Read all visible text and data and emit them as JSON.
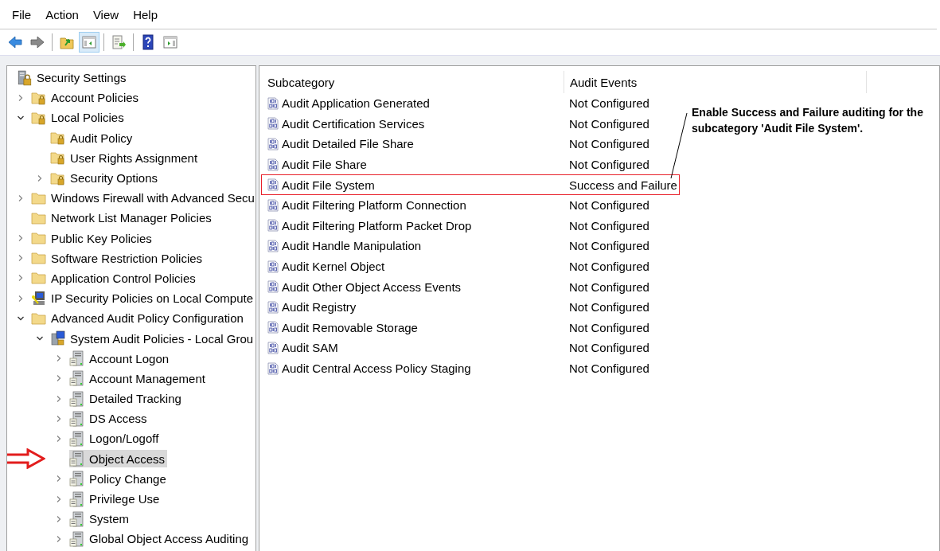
{
  "menu": [
    "File",
    "Action",
    "View",
    "Help"
  ],
  "toolbar": [
    {
      "kind": "back",
      "pressed": false
    },
    {
      "kind": "forward",
      "pressed": false
    },
    {
      "kind": "up",
      "pressed": false
    },
    {
      "kind": "tree",
      "pressed": true
    },
    {
      "kind": "export",
      "pressed": false
    },
    {
      "kind": "help",
      "pressed": false
    },
    {
      "kind": "pane",
      "pressed": false
    }
  ],
  "tree": {
    "label": "Security Settings",
    "kind": "settings",
    "selected": false,
    "children": [
      {
        "label": "Account Policies",
        "kind": "lockfolder",
        "expanded": false,
        "selected": false
      },
      {
        "label": "Local Policies",
        "kind": "lockfolder",
        "expanded": true,
        "selected": false,
        "children": [
          {
            "label": "Audit Policy",
            "kind": "lockfolder",
            "selected": false
          },
          {
            "label": "User Rights Assignment",
            "kind": "lockfolder",
            "selected": false
          },
          {
            "label": "Security Options",
            "kind": "lockfolder",
            "expanded": false,
            "selected": false
          }
        ]
      },
      {
        "label": "Windows Firewall with Advanced Secu",
        "kind": "folder",
        "expanded": false,
        "selected": false
      },
      {
        "label": "Network List Manager Policies",
        "kind": "folder",
        "selected": false
      },
      {
        "label": "Public Key Policies",
        "kind": "folder",
        "expanded": false,
        "selected": false
      },
      {
        "label": "Software Restriction Policies",
        "kind": "folder",
        "expanded": false,
        "selected": false
      },
      {
        "label": "Application Control Policies",
        "kind": "folder",
        "expanded": false,
        "selected": false
      },
      {
        "label": "IP Security Policies on Local Compute",
        "kind": "computer",
        "expanded": false,
        "selected": false
      },
      {
        "label": "Advanced Audit Policy Configuration",
        "kind": "folder",
        "expanded": true,
        "selected": false,
        "children": [
          {
            "label": "System Audit Policies - Local Grou",
            "kind": "gpo",
            "expanded": true,
            "selected": false,
            "children": [
              {
                "label": "Account Logon",
                "kind": "server",
                "expanded": false,
                "selected": false
              },
              {
                "label": "Account Management",
                "kind": "server",
                "expanded": false,
                "selected": false
              },
              {
                "label": "Detailed Tracking",
                "kind": "server",
                "expanded": false,
                "selected": false
              },
              {
                "label": "DS Access",
                "kind": "server",
                "expanded": false,
                "selected": false
              },
              {
                "label": "Logon/Logoff",
                "kind": "server",
                "expanded": false,
                "selected": false
              },
              {
                "label": "Object Access",
                "kind": "server",
                "selected": true
              },
              {
                "label": "Policy Change",
                "kind": "server",
                "expanded": false,
                "selected": false
              },
              {
                "label": "Privilege Use",
                "kind": "server",
                "expanded": false,
                "selected": false
              },
              {
                "label": "System",
                "kind": "server",
                "expanded": false,
                "selected": false
              },
              {
                "label": "Global Object Access Auditing",
                "kind": "server",
                "expanded": false,
                "selected": false
              }
            ]
          }
        ]
      }
    ]
  },
  "list": {
    "columns": [
      "Subcategory",
      "Audit Events"
    ],
    "rows": [
      {
        "subcategory": "Audit Application Generated",
        "audit_events": "Not Configured",
        "highlighted": false
      },
      {
        "subcategory": "Audit Certification Services",
        "audit_events": "Not Configured",
        "highlighted": false
      },
      {
        "subcategory": "Audit Detailed File Share",
        "audit_events": "Not Configured",
        "highlighted": false
      },
      {
        "subcategory": "Audit File Share",
        "audit_events": "Not Configured",
        "highlighted": false
      },
      {
        "subcategory": "Audit File System",
        "audit_events": "Success and Failure",
        "highlighted": true
      },
      {
        "subcategory": "Audit Filtering Platform Connection",
        "audit_events": "Not Configured",
        "highlighted": false
      },
      {
        "subcategory": "Audit Filtering Platform Packet Drop",
        "audit_events": "Not Configured",
        "highlighted": false
      },
      {
        "subcategory": "Audit Handle Manipulation",
        "audit_events": "Not Configured",
        "highlighted": false
      },
      {
        "subcategory": "Audit Kernel Object",
        "audit_events": "Not Configured",
        "highlighted": false
      },
      {
        "subcategory": "Audit Other Object Access Events",
        "audit_events": "Not Configured",
        "highlighted": false
      },
      {
        "subcategory": "Audit Registry",
        "audit_events": "Not Configured",
        "highlighted": false
      },
      {
        "subcategory": "Audit Removable Storage",
        "audit_events": "Not Configured",
        "highlighted": false
      },
      {
        "subcategory": "Audit SAM",
        "audit_events": "Not Configured",
        "highlighted": false
      },
      {
        "subcategory": "Audit Central Access Policy Staging",
        "audit_events": "Not Configured",
        "highlighted": false
      }
    ]
  },
  "callout": {
    "text": "Enable Success and Failure auditing for the subcategory 'Audit File System'."
  }
}
